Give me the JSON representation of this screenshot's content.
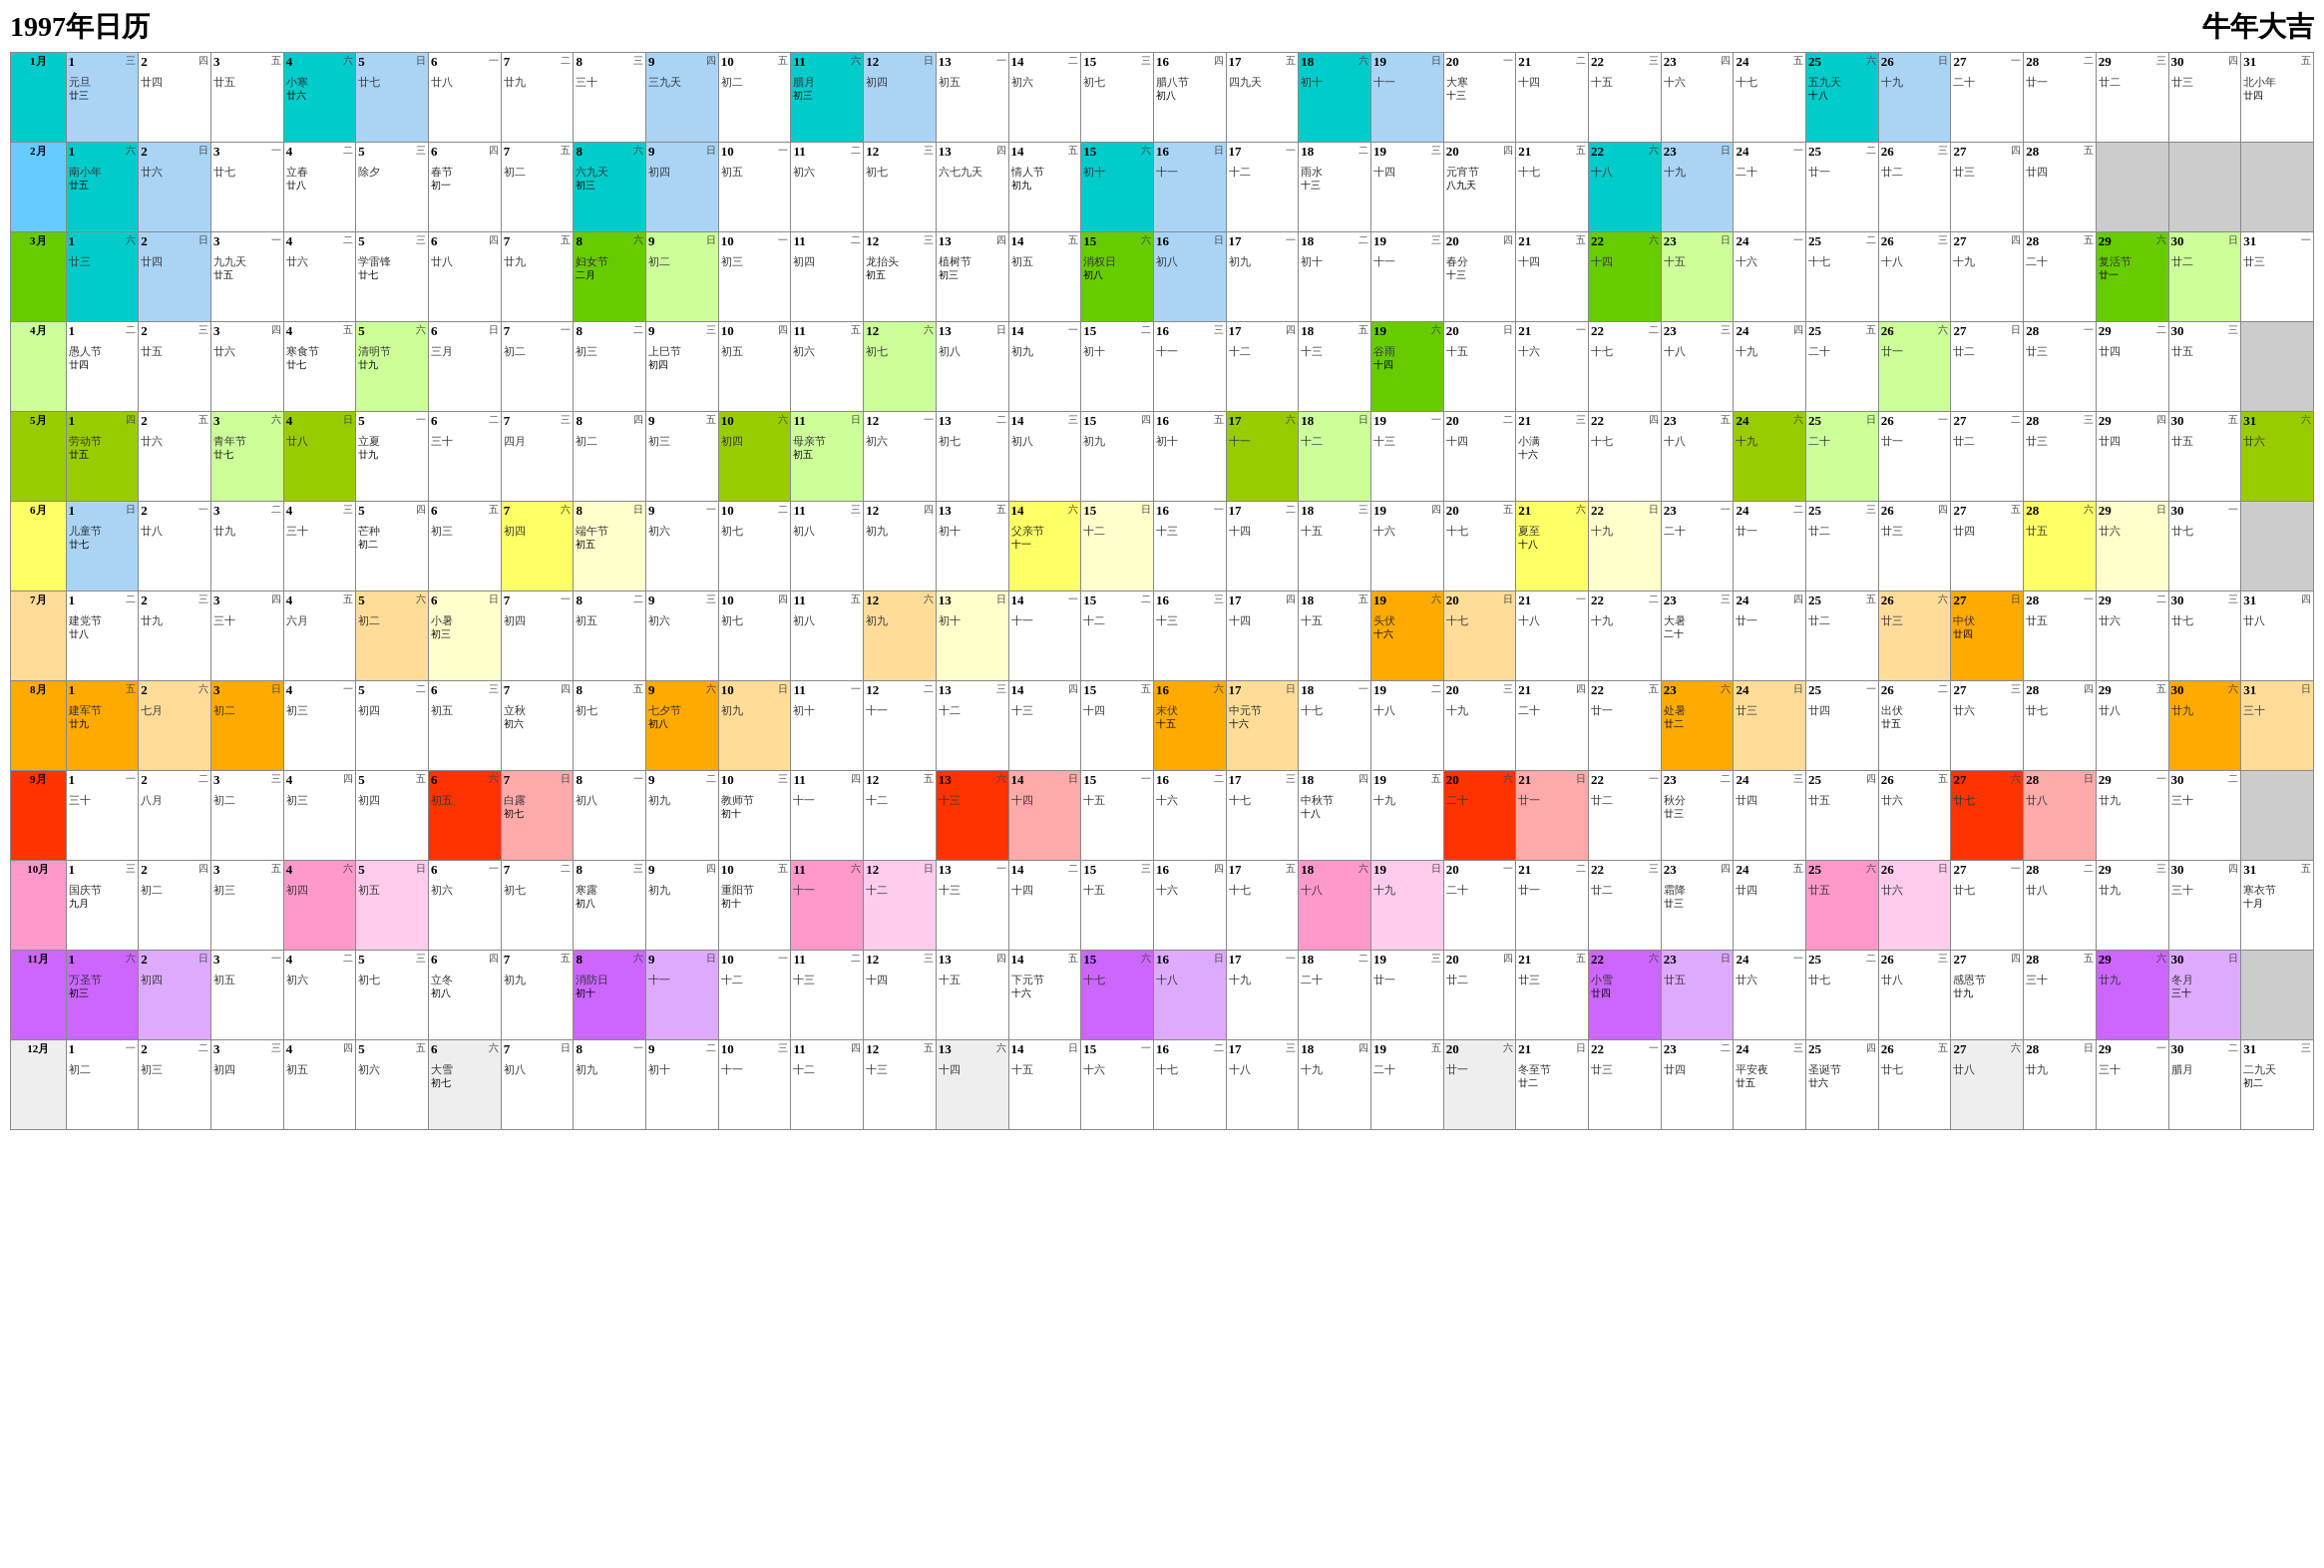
{
  "header": {
    "title": "1997年日历",
    "subtitle": "牛年大吉"
  },
  "months": [
    {
      "label": "1月",
      "color": "bg-cyan"
    },
    {
      "label": "2月",
      "color": "bg-skyblue"
    },
    {
      "label": "3月",
      "color": "bg-green"
    },
    {
      "label": "4月",
      "color": "bg-lightgreen"
    },
    {
      "label": "5月",
      "color": "bg-olive"
    },
    {
      "label": "6月",
      "color": "bg-yellow"
    },
    {
      "label": "7月",
      "color": "bg-lightorange"
    },
    {
      "label": "8月",
      "color": "bg-orange"
    },
    {
      "label": "9月",
      "color": "bg-red"
    },
    {
      "label": "10月",
      "color": "bg-pink"
    },
    {
      "label": "11月",
      "color": "bg-purple"
    },
    {
      "label": "12月",
      "color": "bg-lightgray"
    }
  ]
}
